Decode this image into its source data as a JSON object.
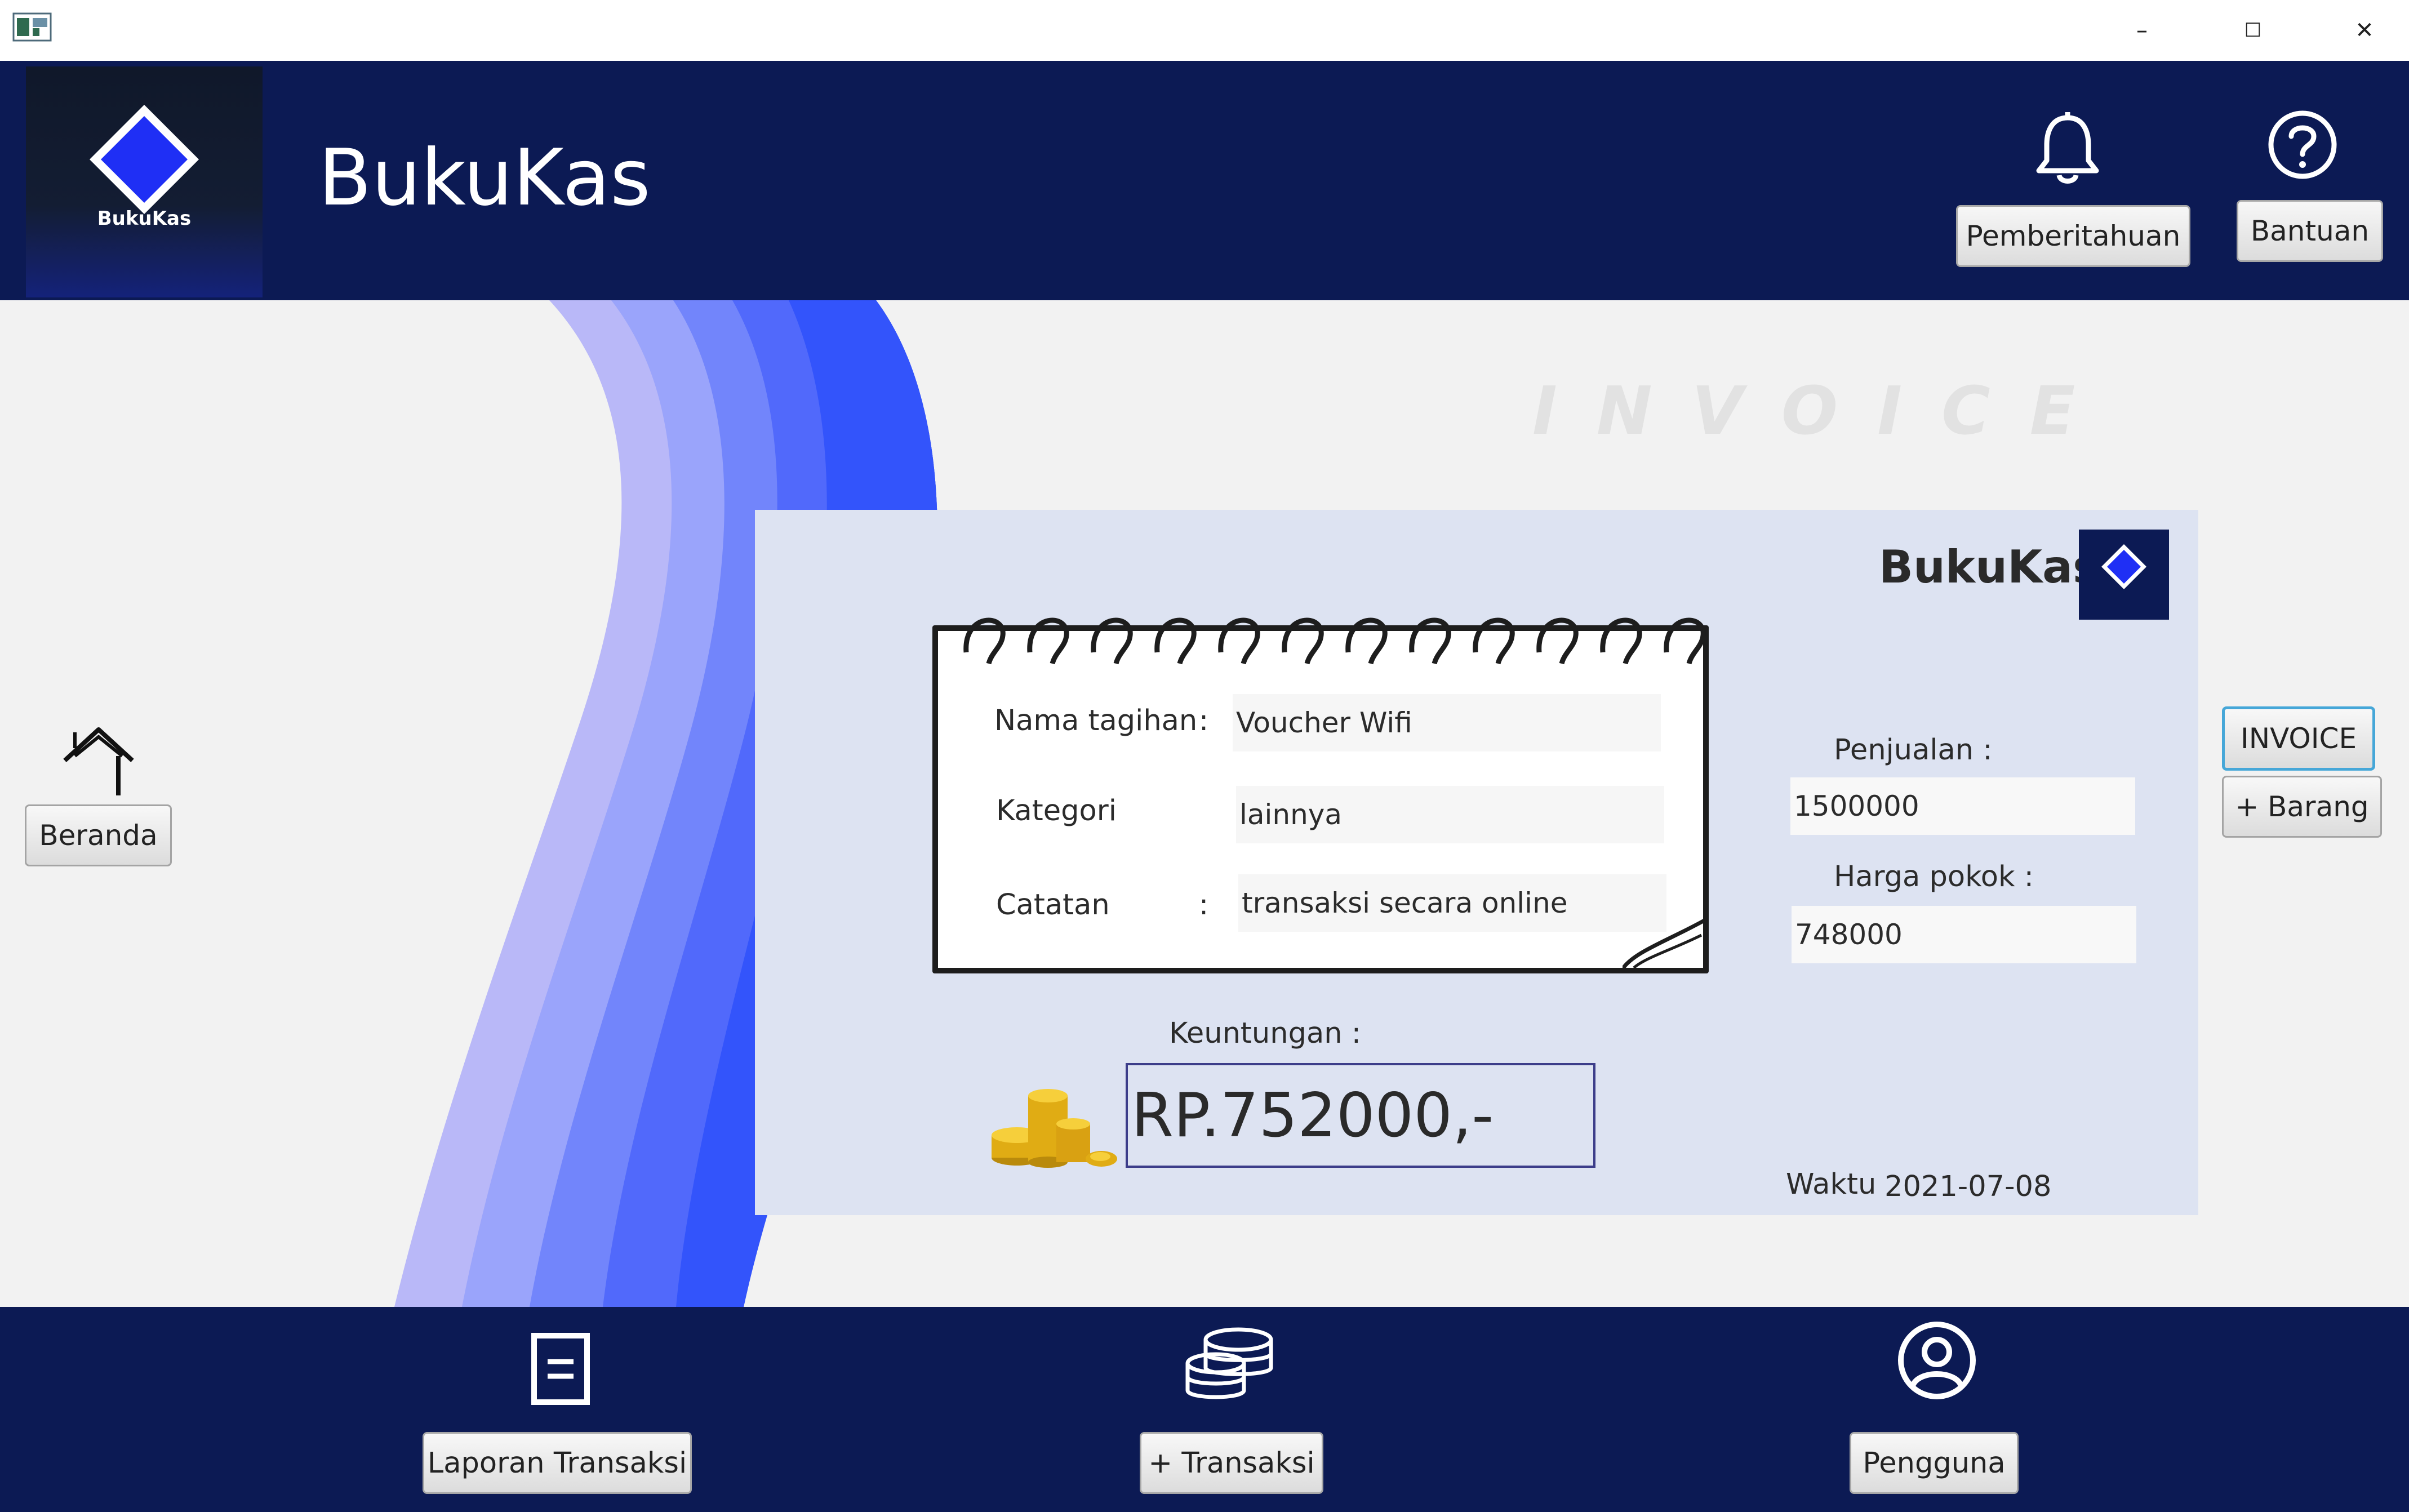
{
  "titlebar": {
    "minimize": "–",
    "maximize": "☐",
    "close": "✕"
  },
  "header": {
    "logo_caption": "BukuKas",
    "title": "BukuKas",
    "notification_label": "Pemberitahuan",
    "help_label": "Bantuan"
  },
  "sidebar": {
    "home_label": "Beranda"
  },
  "invoice": {
    "heading": "INVOICE",
    "brand": "BukuKas",
    "form": {
      "name_label": "Nama tagihan",
      "name_colon": ":",
      "name_value": "Voucher Wifi",
      "category_label": "Kategori",
      "category_value": "lainnya",
      "notes_label": "Catatan",
      "notes_colon": ":",
      "notes_value": "transaksi secara online"
    },
    "sales_label": "Penjualan :",
    "sales_value": "1500000",
    "cost_label": "Harga pokok :",
    "cost_value": "748000",
    "profit_label": "Keuntungan :",
    "profit_value": "RP.752000,-",
    "time_label": "Waktu",
    "time_value": "2021-07-08"
  },
  "right_buttons": {
    "invoice_label": "INVOICE",
    "add_item_label": "+ Barang"
  },
  "footer": {
    "report_label": "Laporan Transaksi",
    "add_transaction_label": "+ Transaksi",
    "user_label": "Pengguna"
  },
  "colors": {
    "header_bg": "#0c1a54",
    "panel_bg": "#dde3f2",
    "logo_diamond": "#1f2ff5",
    "wave_colors": [
      "#b9b8f8",
      "#9aa4fb",
      "#7285fb",
      "#5169fb",
      "#3354fb"
    ]
  },
  "icons": [
    "bell-icon",
    "help-icon",
    "home-icon",
    "document-icon",
    "coins-stack-icon",
    "user-circle-icon",
    "gold-coins-icon"
  ]
}
